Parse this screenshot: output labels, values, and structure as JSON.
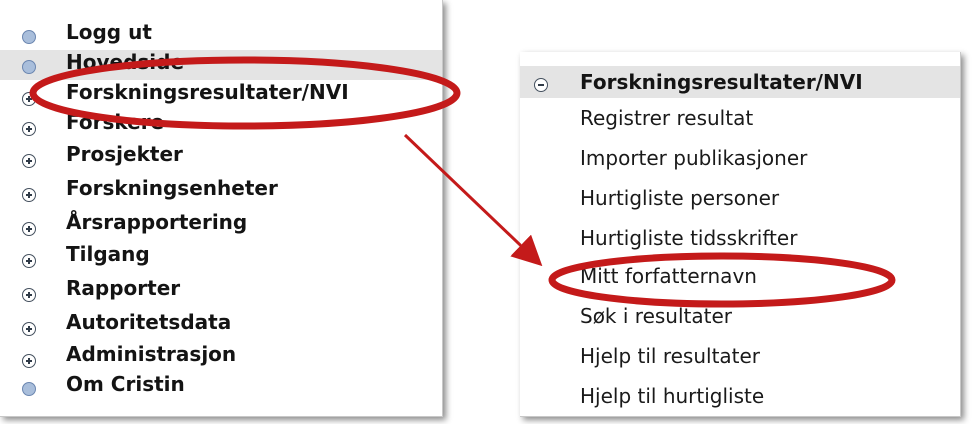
{
  "left_menu": {
    "items": [
      {
        "label": "Logg ut",
        "icon": "dot-icon"
      },
      {
        "label": "Hovedside",
        "icon": "dot-icon"
      },
      {
        "label": "Forskningsresultater/NVI",
        "icon": "plus-icon"
      },
      {
        "label": "Forskere",
        "icon": "plus-icon"
      },
      {
        "label": "Prosjekter",
        "icon": "plus-icon"
      },
      {
        "label": "Forskningsenheter",
        "icon": "plus-icon"
      },
      {
        "label": "Årsrapportering",
        "icon": "plus-icon"
      },
      {
        "label": "Tilgang",
        "icon": "plus-icon"
      },
      {
        "label": "Rapporter",
        "icon": "plus-icon"
      },
      {
        "label": "Autoritetsdata",
        "icon": "plus-icon"
      },
      {
        "label": "Administrasjon",
        "icon": "plus-icon"
      },
      {
        "label": "Om Cristin",
        "icon": "dot-icon"
      }
    ]
  },
  "expanded_menu": {
    "header": {
      "label": "Forskningsresultater/NVI",
      "icon": "minus-icon"
    },
    "items": [
      "Registrer resultat",
      "Importer publikasjoner",
      "Hurtigliste personer",
      "Hurtigliste tidsskrifter",
      "Mitt forfatternavn",
      "Søk i resultater",
      "Hjelp til resultater",
      "Hjelp til hurtigliste"
    ]
  },
  "colors": {
    "annotation_red": "#c41a1a",
    "highlight_row": "#e4e4e4",
    "dot_icon_fill": "#a9bedb"
  }
}
